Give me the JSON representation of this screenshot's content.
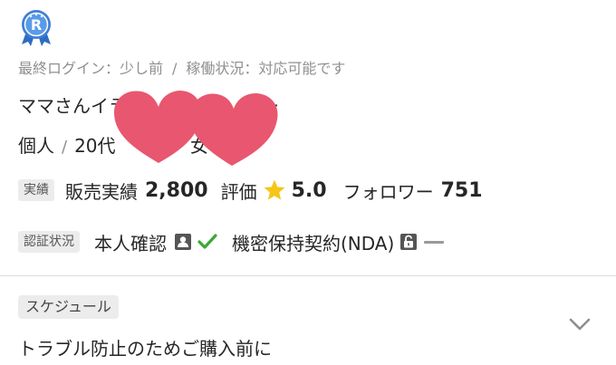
{
  "header": {
    "rank_badge_icon": "rank-r-badge-icon",
    "last_login": "最終ログイン：少し前",
    "separator": "/",
    "work_status": "稼働状況：対応可能です"
  },
  "profile": {
    "name": "ママさんイラス",
    "name_tail": "ー",
    "type": "個人",
    "slash": "/",
    "age": "20代",
    "gender": "女"
  },
  "stats": {
    "tag": "実績",
    "sales_label": "販売実績",
    "sales_value": "2,800",
    "rating_label": "評価",
    "rating_icon": "star-icon",
    "rating_value": "5.0",
    "followers_label": "フォロワー",
    "followers_value": "751"
  },
  "verification": {
    "tag": "認証状況",
    "identity_label": "本人確認",
    "identity_icons": [
      "id-card-icon",
      "check-icon"
    ],
    "nda_label": "機密保持契約(NDA)",
    "nda_icons": [
      "lock-icon",
      "dash-icon"
    ]
  },
  "schedule": {
    "tag": "スケジュール",
    "title": "トラブル防止のためご購入前に",
    "expand_icon": "chevron-down-icon"
  },
  "colors": {
    "badge_blue": "#3f7fd6",
    "heart_pink": "#e8576f",
    "star_gold": "#f5c518",
    "check_green": "#3aa832",
    "muted_text": "#8f8f8f",
    "tag_bg": "#ececec"
  }
}
